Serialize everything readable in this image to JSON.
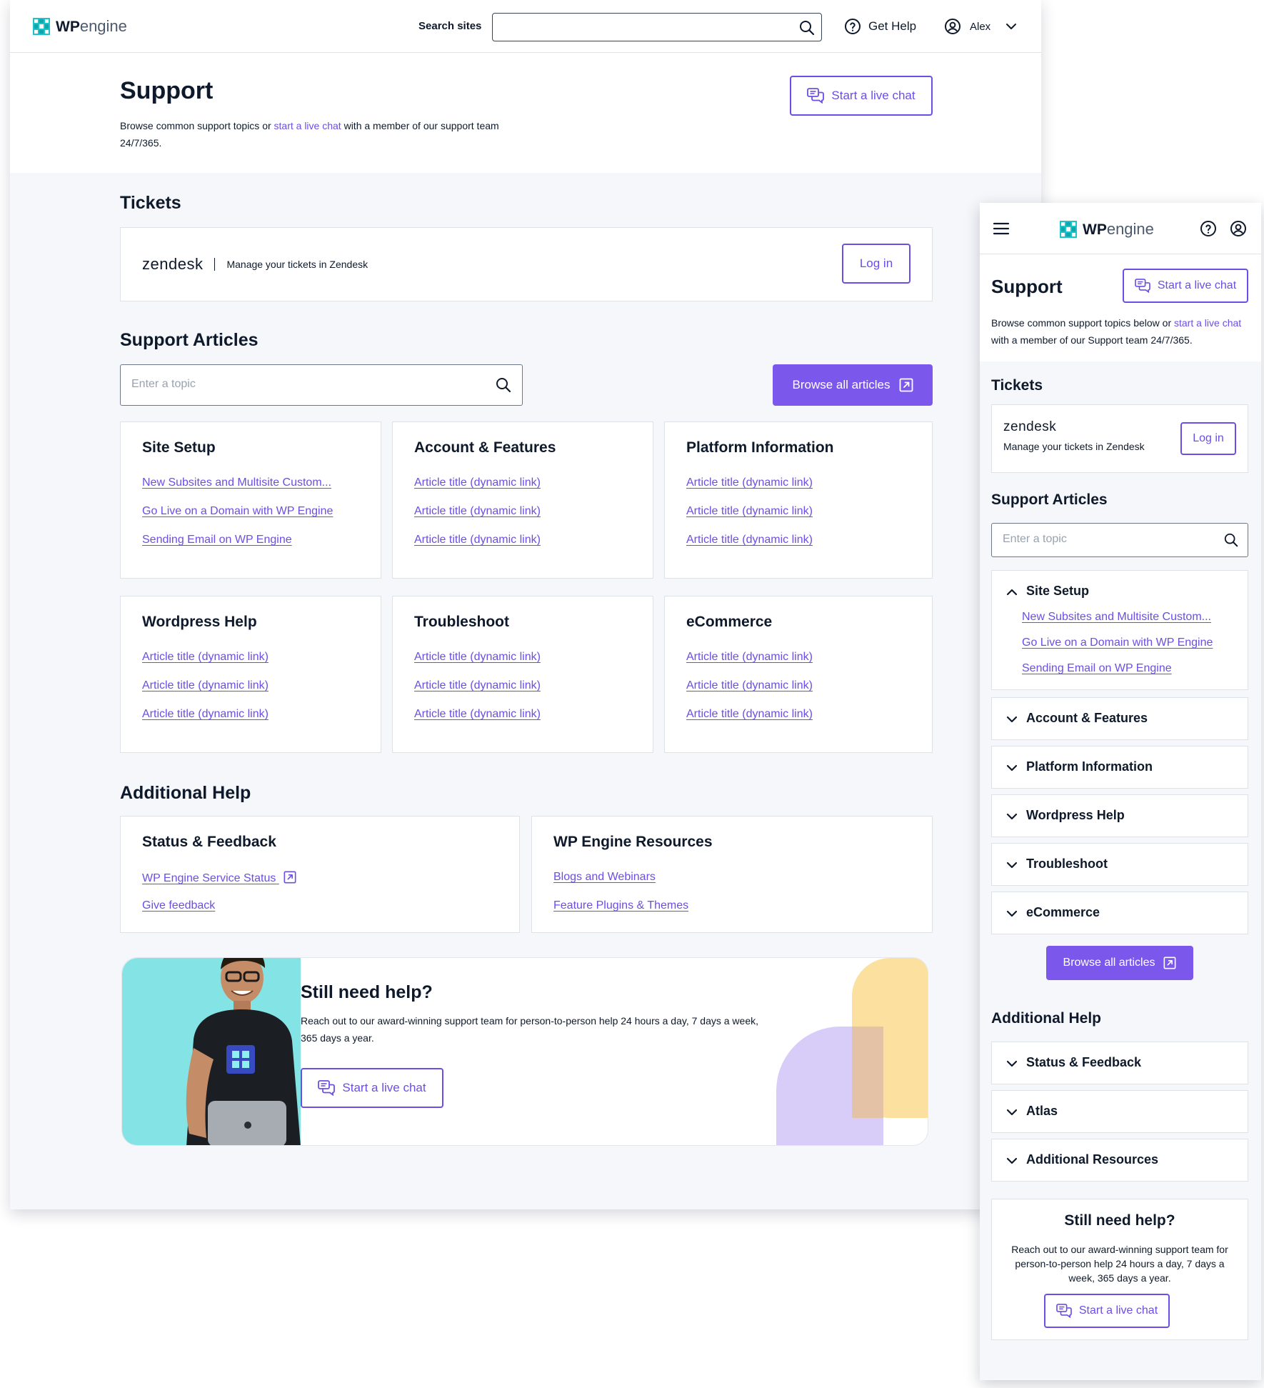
{
  "brand": {
    "logo_bold": "WP",
    "logo_light": "engine",
    "accent": "#6c4ee4",
    "button_fill": "#7b57ec",
    "logo_color": "#1fc2c8"
  },
  "desktop": {
    "header": {
      "search_label": "Search sites",
      "search_icon": "search-icon",
      "get_help": "Get Help",
      "user_name": "Alex"
    },
    "hero": {
      "title": "Support",
      "subtitle_before": "Browse common support topics or ",
      "subtitle_link": "start a live chat",
      "subtitle_after": " with a member of our support team 24/7/365.",
      "live_chat_button": "Start a live chat"
    },
    "tickets": {
      "heading": "Tickets",
      "brand": "zendesk",
      "description": "Manage your tickets in Zendesk",
      "login_button": "Log in"
    },
    "articles": {
      "heading": "Support Articles",
      "search_placeholder": "Enter a topic",
      "browse_button": "Browse all articles",
      "categories": [
        {
          "title": "Site Setup",
          "links": [
            "New Subsites and Multisite Custom...",
            "Go Live on a Domain with WP Engine",
            "Sending Email on WP Engine"
          ]
        },
        {
          "title": "Account & Features",
          "links": [
            "Article title (dynamic link)",
            "Article title (dynamic link)",
            "Article title (dynamic link)"
          ]
        },
        {
          "title": "Platform Information",
          "links": [
            "Article title (dynamic link)",
            "Article title (dynamic link)",
            "Article title (dynamic link)"
          ]
        },
        {
          "title": "Wordpress Help",
          "links": [
            "Article title (dynamic link)",
            "Article title (dynamic link)",
            "Article title (dynamic link)"
          ]
        },
        {
          "title": "Troubleshoot",
          "links": [
            "Article title (dynamic link)",
            "Article title (dynamic link)",
            "Article title (dynamic link)"
          ]
        },
        {
          "title": "eCommerce",
          "links": [
            "Article title (dynamic link)",
            "Article title (dynamic link)",
            "Article title (dynamic link)"
          ]
        }
      ]
    },
    "additional": {
      "heading": "Additional Help",
      "status": {
        "title": "Status & Feedback",
        "links": [
          "WP Engine Service Status",
          "Give feedback"
        ]
      },
      "resources": {
        "title": "WP Engine Resources",
        "links": [
          "Blogs and Webinars",
          "Feature Plugins & Themes"
        ]
      }
    },
    "banner": {
      "title": "Still need help?",
      "text": "Reach out to our award-winning support team for person-to-person help 24 hours a day, 7 days a week, 365 days a year.",
      "button": "Start a live chat"
    }
  },
  "mobile": {
    "hero": {
      "title": "Support",
      "live_chat_button": "Start a live chat",
      "subtitle_before": "Browse common support topics below or ",
      "subtitle_link": "start a live chat",
      "subtitle_after": " with a member of our Support team 24/7/365."
    },
    "tickets": {
      "heading": "Tickets",
      "brand": "zendesk",
      "description": "Manage your tickets in Zendesk",
      "login_button": "Log in"
    },
    "articles": {
      "heading": "Support Articles",
      "search_placeholder": "Enter a topic",
      "expanded": {
        "title": "Site Setup",
        "links": [
          "New Subsites and Multisite Custom...",
          "Go Live on a Domain with WP Engine",
          "Sending Email on WP Engine"
        ]
      },
      "collapsed": [
        "Account & Features",
        "Platform Information",
        "Wordpress Help",
        "Troubleshoot",
        "eCommerce"
      ],
      "browse_button": "Browse all articles"
    },
    "additional": {
      "heading": "Additional Help",
      "items": [
        "Status & Feedback",
        "Atlas",
        "Additional Resources"
      ]
    },
    "banner": {
      "title": "Still need help?",
      "text": "Reach out to our award-winning support team for person-to-person help 24 hours a day, 7 days a week, 365 days a year.",
      "button": "Start a live chat"
    }
  }
}
